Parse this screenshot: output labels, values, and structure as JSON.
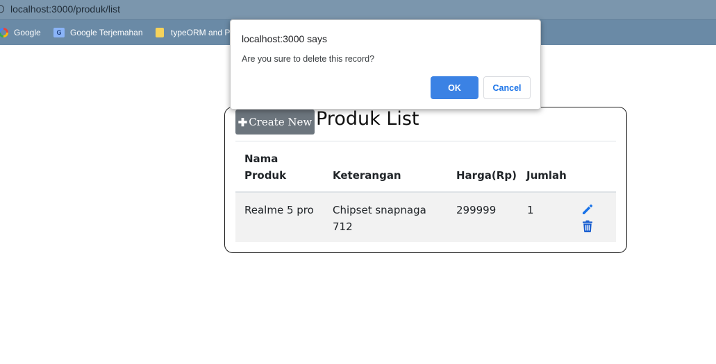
{
  "browser": {
    "url": "localhost:3000/produk/list",
    "bookmarks": [
      {
        "label": "Google",
        "icon": "google-icon"
      },
      {
        "label": "Google Terjemahan",
        "icon": "google-translate-icon"
      },
      {
        "label": "typeORM and Pi",
        "icon": "folder-icon"
      }
    ]
  },
  "page": {
    "create_label": "Create New",
    "title": "Produk List",
    "table": {
      "headers": [
        "Nama Produk",
        "Keterangan",
        "Harga(Rp)",
        "Jumlah"
      ],
      "rows": [
        {
          "nama": "Realme 5 pro",
          "keterangan": "Chipset snapnaga 712",
          "harga": "299999",
          "jumlah": "1"
        }
      ]
    }
  },
  "dialog": {
    "title": "localhost:3000 says",
    "message": "Are you sure to delete this record?",
    "ok_label": "OK",
    "cancel_label": "Cancel"
  },
  "colors": {
    "chrome_bar": "#7b96ad",
    "bookmark_bar": "#6a8aa6",
    "create_button": "#6c757d",
    "ok_button": "#3b82e4",
    "action_icons": "#1a5fd0"
  }
}
